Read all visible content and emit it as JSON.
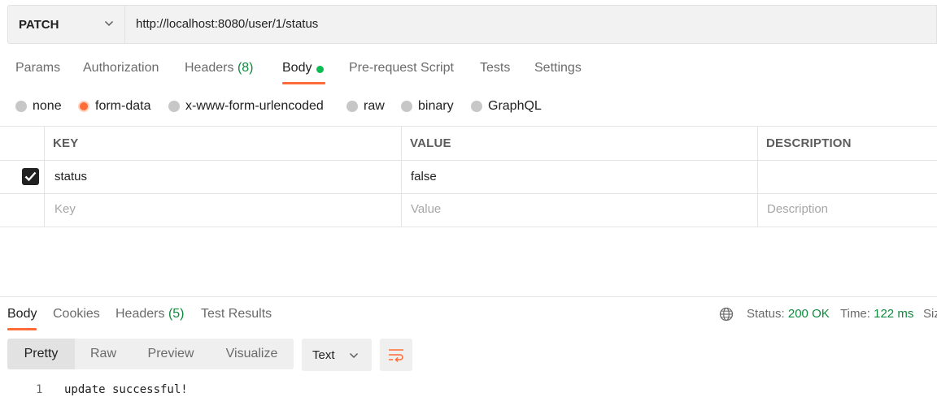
{
  "request": {
    "method": "PATCH",
    "url": "http://localhost:8080/user/1/status"
  },
  "request_tabs": {
    "params": "Params",
    "authorization": "Authorization",
    "headers": "Headers",
    "headers_count": "(8)",
    "body": "Body",
    "prerequest": "Pre-request Script",
    "tests": "Tests",
    "settings": "Settings"
  },
  "body_types": {
    "none": "none",
    "form_data": "form-data",
    "urlencoded": "x-www-form-urlencoded",
    "raw": "raw",
    "binary": "binary",
    "graphql": "GraphQL",
    "selected": "form-data"
  },
  "params_table": {
    "headers": {
      "key": "KEY",
      "value": "VALUE",
      "description": "DESCRIPTION"
    },
    "rows": [
      {
        "checked": true,
        "key": "status",
        "value": "false",
        "description": ""
      }
    ],
    "placeholders": {
      "key": "Key",
      "value": "Value",
      "description": "Description"
    }
  },
  "response": {
    "tabs": {
      "body": "Body",
      "cookies": "Cookies",
      "headers": "Headers",
      "headers_count": "(5)",
      "test_results": "Test Results"
    },
    "status_label": "Status:",
    "status_value": "200 OK",
    "time_label": "Time:",
    "time_value": "122 ms",
    "size_label_partial": "Siz",
    "view_modes": {
      "pretty": "Pretty",
      "raw": "Raw",
      "preview": "Preview",
      "visualize": "Visualize",
      "selected": "Pretty"
    },
    "format": "Text",
    "lines": [
      {
        "no": "1",
        "text": "update successful!"
      }
    ]
  },
  "colors": {
    "accent": "#ff6c37",
    "success": "#0d8a3c",
    "body_dot": "#0cbb52"
  },
  "icons": [
    "chevron-down-icon",
    "checkmark-icon",
    "globe-icon",
    "wrap-lines-icon"
  ]
}
